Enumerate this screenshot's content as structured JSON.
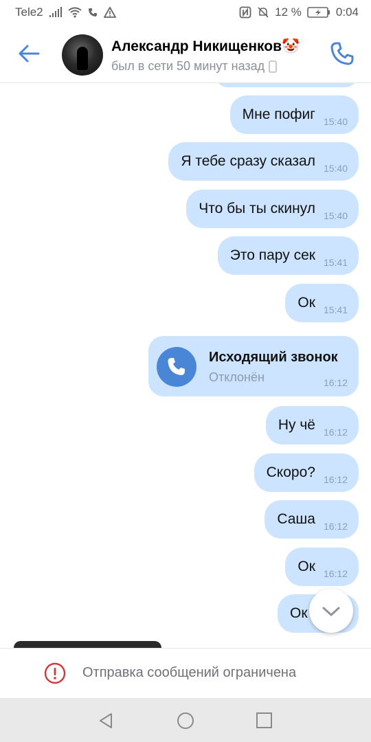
{
  "status_bar": {
    "carrier": "Tele2",
    "battery": "12 %",
    "time": "0:04"
  },
  "header": {
    "contact_name": "Александр Никищенков",
    "contact_emoji": "🤡",
    "last_seen": "был в сети 50 минут назад"
  },
  "messages": [
    {
      "text": "Мне пофиг",
      "time": "15:40"
    },
    {
      "text": "Я тебе сразу сказал",
      "time": "15:40"
    },
    {
      "text": "Что бы ты скинул",
      "time": "15:40"
    },
    {
      "text": "Это пару сек",
      "time": "15:41"
    },
    {
      "text": "Ок",
      "time": "15:41"
    },
    {
      "text": "Ну чё",
      "time": "16:12"
    },
    {
      "text": "Скоро?",
      "time": "16:12"
    },
    {
      "text": "Саша",
      "time": "16:12"
    },
    {
      "text": "Ок",
      "time": "16:12"
    },
    {
      "text": "Ок",
      "time": ""
    }
  ],
  "call_message": {
    "title": "Исходящий звонок",
    "status": "Отклонён",
    "time": "16:12"
  },
  "footer": {
    "restriction_text": "Отправка сообщений ограничена"
  },
  "colors": {
    "accent": "#4a86d6",
    "bubble": "#cce4ff",
    "restriction_icon": "#d0393b"
  },
  "icons": [
    "back-arrow-icon",
    "phone-icon",
    "chevron-down-icon",
    "warning-circle-icon",
    "nav-back-icon",
    "nav-home-icon",
    "nav-recents-icon"
  ]
}
